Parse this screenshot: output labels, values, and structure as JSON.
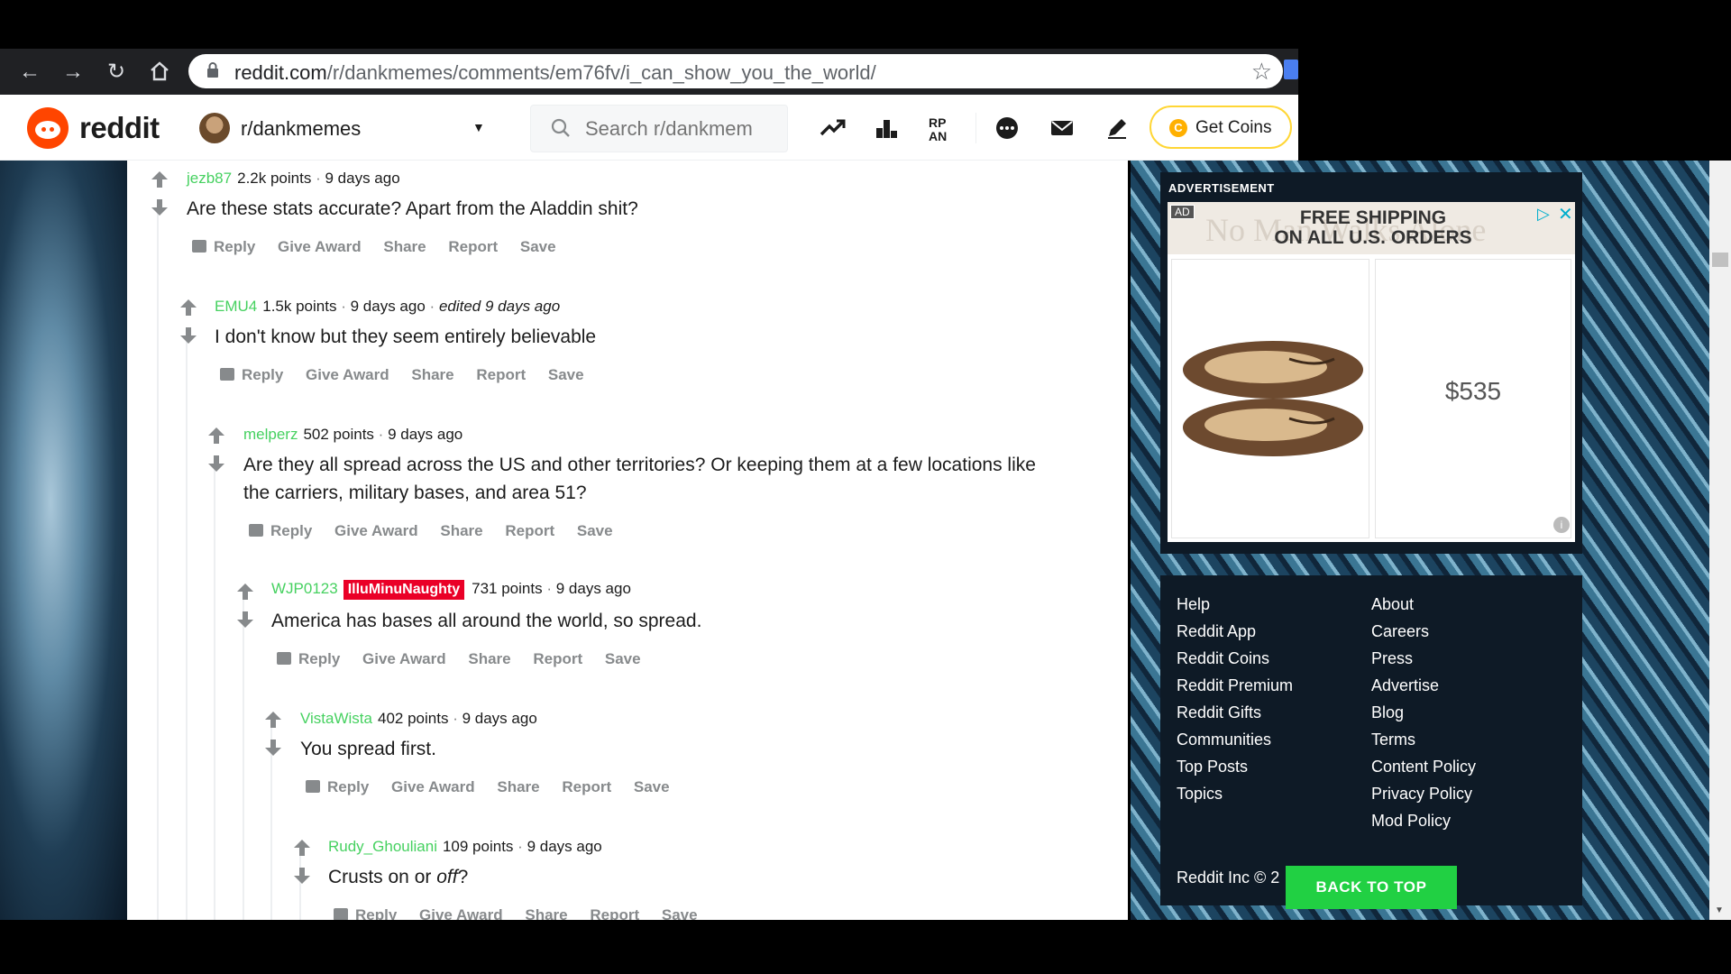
{
  "browser": {
    "url_domain": "reddit.com",
    "url_path": "/r/dankmemes/comments/em76fv/i_can_show_you_the_world/"
  },
  "header": {
    "wordmark": "reddit",
    "subreddit": "r/dankmemes",
    "search_placeholder": "Search r/dankmem",
    "coins_label": "Get Coins",
    "coin_symbol": "C"
  },
  "comments": [
    {
      "user": "jezb87",
      "points": "2.2k points",
      "time": "9 days ago",
      "edited": "",
      "flair": "",
      "body": "Are these stats accurate? Apart from the Aladdin shit?"
    },
    {
      "user": "EMU4",
      "points": "1.5k points",
      "time": "9 days ago",
      "edited": "edited 9 days ago",
      "flair": "",
      "body": "I don't know but they seem entirely believable"
    },
    {
      "user": "melperz",
      "points": "502 points",
      "time": "9 days ago",
      "edited": "",
      "flair": "",
      "body": "Are they all spread across the US and other territories? Or keeping them at a few locations like the carriers, military bases, and area 51?"
    },
    {
      "user": "WJP0123",
      "points": "731 points",
      "time": "9 days ago",
      "edited": "",
      "flair": "IlluMinuNaughty",
      "body": "America has bases all around the world, so spread."
    },
    {
      "user": "VistaWista",
      "points": "402 points",
      "time": "9 days ago",
      "edited": "",
      "flair": "",
      "body": "You spread first."
    },
    {
      "user": "Rudy_Ghouliani",
      "points": "109 points",
      "time": "9 days ago",
      "edited": "",
      "flair": "",
      "body_prefix": "Crusts on or ",
      "body_em": "off",
      "body_suffix": "?"
    }
  ],
  "actions": {
    "reply": "Reply",
    "give_award": "Give Award",
    "share": "Share",
    "report": "Report",
    "save": "Save"
  },
  "separator": "·",
  "ad": {
    "heading": "ADVERTISEMENT",
    "tag": "AD",
    "watermark": "No Man Walks Alone",
    "headline_line1": "FREE SHIPPING",
    "headline_line2": "ON ALL U.S. ORDERS",
    "price": "$535",
    "info": "i"
  },
  "footer": {
    "left": [
      "Help",
      "Reddit App",
      "Reddit Coins",
      "Reddit Premium",
      "Reddit Gifts",
      "Communities",
      "Top Posts",
      "Topics"
    ],
    "right": [
      "About",
      "Careers",
      "Press",
      "Advertise",
      "Blog",
      "Terms",
      "Content Policy",
      "Privacy Policy",
      "Mod Policy"
    ],
    "copyright": "Reddit Inc © 2",
    "back_to_top": "BACK TO TOP"
  },
  "colors": {
    "username": "#46d160",
    "flair": "#ea0027",
    "brand": "#ff4500",
    "back_to_top": "#21d043",
    "coins_border": "#ffd635"
  },
  "icons": [
    "back-arrow-icon",
    "forward-arrow-icon",
    "reload-icon",
    "home-icon",
    "lock-icon",
    "star-icon",
    "search-icon",
    "trending-icon",
    "leaderboard-icon",
    "rpan-icon",
    "chat-icon",
    "mail-icon",
    "pencil-icon",
    "upvote-icon",
    "downvote-icon",
    "reply-icon",
    "info-icon",
    "close-icon",
    "play-icon"
  ]
}
